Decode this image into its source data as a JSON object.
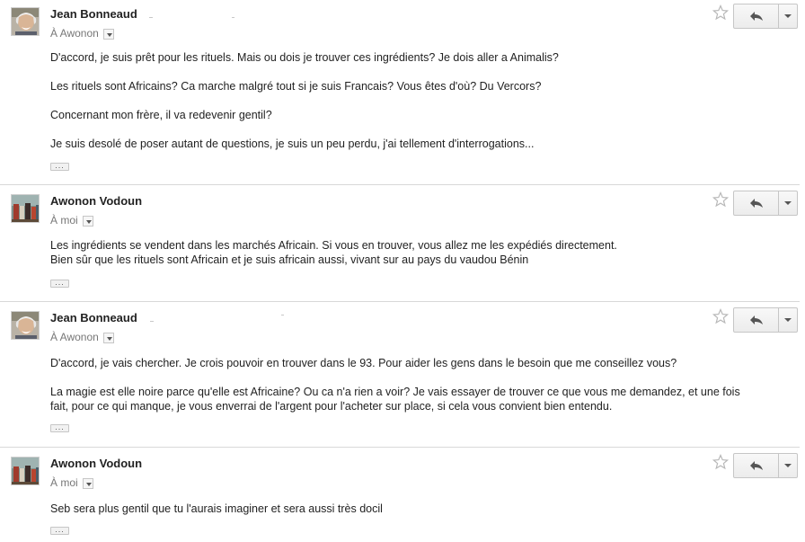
{
  "messages": [
    {
      "sender": "Jean Bonneaud",
      "recipient": "À Awonon",
      "avatar": "jean-avatar",
      "paragraphs": [
        "D'accord, je suis prêt pour les rituels. Mais ou dois je trouver ces ingrédients? Je dois aller a Animalis?",
        "Les rituels sont Africains? Ca marche malgré tout si je suis Francais? Vous êtes d'où? Du Vercors?",
        "Concernant mon frère, il va redevenir gentil?",
        "Je suis desolé de poser autant de questions, je suis un peu perdu, j'ai tellement d'interrogations..."
      ],
      "ellipsis": "...",
      "star_icon": "star-outline-icon",
      "reply_icon": "reply-arrow-icon",
      "more_icon": "caret-down-icon"
    },
    {
      "sender": "Awonon Vodoun",
      "recipient": "À moi",
      "avatar": "awonon-avatar",
      "paragraphs": [
        "Les ingrédients se vendent dans les marchés Africain. Si vous en trouver, vous allez me les expédiés directement.",
        "Bien sûr que les rituels sont Africain et je suis africain aussi, vivant sur au pays du vaudou Bénin"
      ],
      "ellipsis": "..."
    },
    {
      "sender": "Jean Bonneaud",
      "recipient": "À Awonon",
      "avatar": "jean-avatar",
      "paragraphs": [
        "D'accord, je vais chercher. Je crois pouvoir en trouver dans le 93. Pour aider les gens dans le besoin que me conseillez vous?",
        "La magie est elle noire parce qu'elle est Africaine? Ou ca n'a rien a voir? Je vais essayer de trouver ce que vous me demandez, et une fois",
        "fait, pour ce qui manque, je vous enverrai de l'argent pour l'acheter sur place, si cela vous convient bien entendu."
      ],
      "ellipsis": "..."
    },
    {
      "sender": "Awonon Vodoun",
      "recipient": "À moi",
      "avatar": "awonon-avatar",
      "paragraphs": [
        "Seb sera plus gentil que tu l'aurais imaginer et sera aussi très docil"
      ],
      "ellipsis": "..."
    }
  ],
  "colors": {
    "divider": "#d8d8d8",
    "sender": "#222222",
    "recipient": "#777777",
    "button_border": "#c6c6c6"
  }
}
